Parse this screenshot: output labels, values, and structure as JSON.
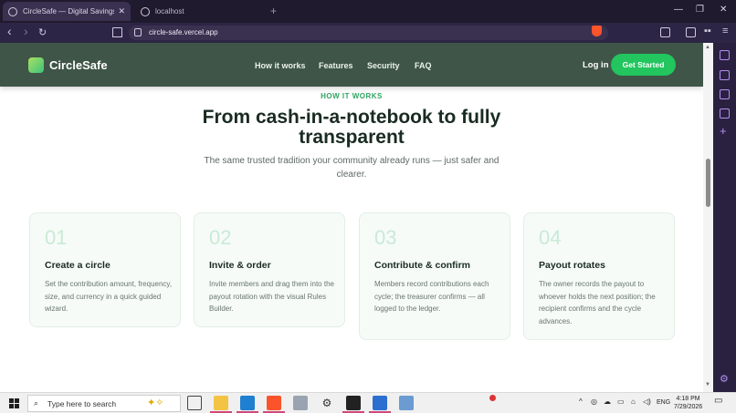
{
  "browser": {
    "tabs": [
      {
        "title": "CircleSafe — Digital Savings Circ",
        "close": "✕"
      },
      {
        "title": "localhost"
      }
    ],
    "new_tab": "+",
    "window_controls": {
      "minimize": "—",
      "maximize": "❐",
      "close": "✕"
    },
    "address": "circle-safe.vercel.app",
    "nav": {
      "back": "‹",
      "forward": "›",
      "reload": "↻"
    }
  },
  "site": {
    "brand": "CircleSafe",
    "nav_links": [
      "How it works",
      "Features",
      "Security",
      "FAQ"
    ],
    "login": "Log in",
    "cta": "Get Started",
    "section": {
      "eyebrow": "HOW IT WORKS",
      "headline": "From cash-in-a-notebook to fully transparent",
      "subtext": "The same trusted tradition your community already runs — just safer and clearer."
    },
    "steps": [
      {
        "num": "01",
        "title": "Create a circle",
        "desc": "Set the contribution amount, frequency, size, and currency in a quick guided wizard."
      },
      {
        "num": "02",
        "title": "Invite & order",
        "desc": "Invite members and drag them into the payout rotation with the visual Rules Builder."
      },
      {
        "num": "03",
        "title": "Contribute & confirm",
        "desc": "Members record contributions each cycle; the treasurer confirms — all logged to the ledger."
      },
      {
        "num": "04",
        "title": "Payout rotates",
        "desc": "The owner records the payout to whoever holds the next position; the recipient confirms and the cycle advances."
      }
    ]
  },
  "taskbar": {
    "search_placeholder": "Type here to search",
    "language": "ENG",
    "time": "4:18 PM",
    "date": "7/29/2026"
  },
  "colors": {
    "nav_bg": "#3f5547",
    "accent": "#22c55e",
    "eyebrow": "#2fa561"
  }
}
